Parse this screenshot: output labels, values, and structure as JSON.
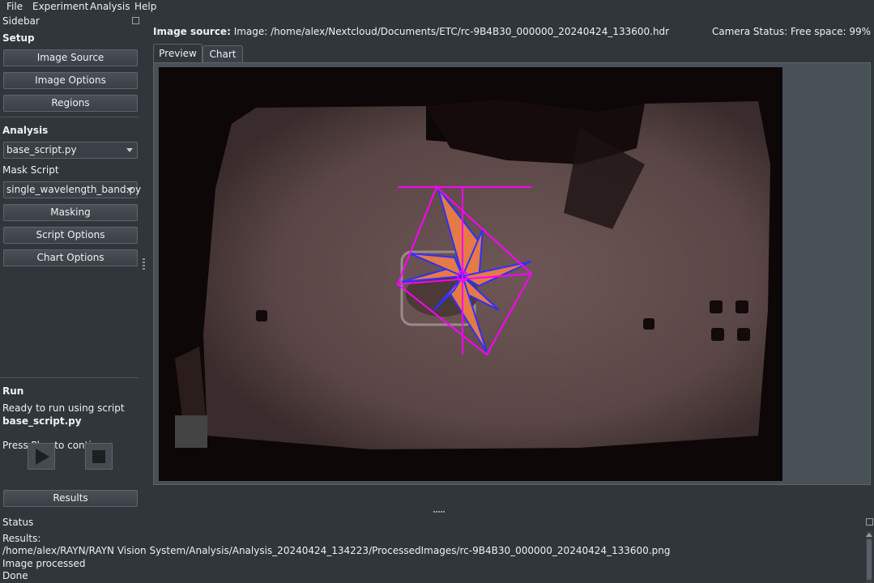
{
  "menu": [
    "File",
    "Experiment",
    "Analysis",
    "Help"
  ],
  "sidebar": {
    "title": "Sidebar",
    "setup": {
      "heading": "Setup",
      "buttons": [
        "Image Source",
        "Image Options",
        "Regions"
      ]
    },
    "analysis": {
      "heading": "Analysis",
      "script_value": "base_script.py",
      "mask_label": "Mask Script",
      "mask_value": "single_wavelength_band.py",
      "buttons": [
        "Masking",
        "Script Options",
        "Chart Options"
      ]
    },
    "run": {
      "heading": "Run",
      "ready_text": "Ready to run using script",
      "script_name": "base_script.py",
      "prompt": "Press Play to continue",
      "results_button": "Results"
    }
  },
  "header": {
    "source_label": "Image source:",
    "source_value": "Image: /home/alex/Nextcloud/Documents/ETC/rc-9B4B30_000000_20240424_133600.hdr",
    "camera_status": "Camera Status: Free space: 99%"
  },
  "tabs": [
    {
      "label": "Preview",
      "active": true
    },
    {
      "label": "Chart",
      "active": false
    }
  ],
  "status": {
    "title": "Status",
    "lines": [
      "Results:",
      "/home/alex/RAYN/RAYN Vision System/Analysis/Analysis_20240424_134223/ProcessedImages/rc-9B4B30_000000_20240424_133600.png",
      "Image processed",
      "Done"
    ]
  },
  "colors": {
    "background": "#31363b",
    "overlay": "#ff00ff",
    "plant_outline": "#3030ff",
    "leaf": "#e57a45"
  }
}
